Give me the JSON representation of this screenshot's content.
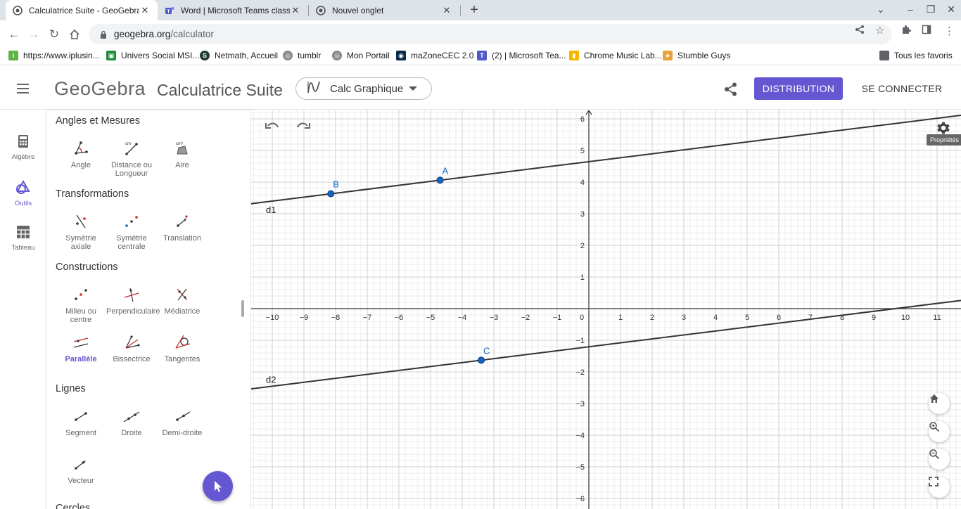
{
  "browser": {
    "tabs": [
      {
        "title": "Calculatrice Suite - GeoGebra",
        "active": true
      },
      {
        "title": "Word | Microsoft Teams classic",
        "active": false
      },
      {
        "title": "Nouvel onglet",
        "active": false
      }
    ],
    "url_domain": "geogebra.org",
    "url_path": "/calculator",
    "bookmarks": [
      "https://www.iplusin...",
      "Univers Social MSI...",
      "Netmath, Accueil",
      "tumblr",
      "Mon Portail",
      "maZoneCEC 2.0",
      "(2) | Microsoft Tea...",
      "Chrome Music Lab...",
      "Stumble Guys"
    ],
    "all_bookmarks": "Tous les favoris"
  },
  "header": {
    "logo": "GeoGebra",
    "app_name": "Calculatrice Suite",
    "app_select": "Calc Graphique",
    "distribution_label": "DISTRIBUTION",
    "login_label": "SE CONNECTER"
  },
  "rail": {
    "algebra": "Algèbre",
    "tools": "Outils",
    "table": "Tableau"
  },
  "tools_panel": {
    "categories": {
      "angles": "Angles et Mesures",
      "transformations": "Transformations",
      "constructions": "Constructions",
      "lines": "Lignes",
      "cut": "Cercles"
    },
    "tools": {
      "angle": "Angle",
      "distance": "Distance ou Longueur",
      "area": "Aire",
      "reflect_line": "Symétrie axiale",
      "reflect_point": "Symétrie centrale",
      "translation": "Translation",
      "midpoint": "Milieu ou centre",
      "perpendicular": "Perpendiculaire",
      "bisector_perp": "Médiatrice",
      "parallel": "Parallèle",
      "angle_bisector": "Bissectrice",
      "tangents": "Tangentes",
      "segment": "Segment",
      "line": "Droite",
      "ray": "Demi-droite",
      "vector": "Vecteur"
    }
  },
  "graphics": {
    "x_ticks": [
      -10,
      -9,
      -8,
      -7,
      -6,
      -5,
      -4,
      -3,
      -2,
      -1,
      0,
      1,
      2,
      3,
      4,
      5,
      6,
      7,
      8,
      9,
      10,
      11
    ],
    "y_ticks": [
      6,
      5,
      4,
      3,
      2,
      1,
      -1,
      -2,
      -3,
      -4,
      -5,
      -6
    ],
    "settings_tooltip": "Propriétés",
    "points": [
      {
        "label": "A",
        "x": -4.7,
        "y": 4.06
      },
      {
        "label": "B",
        "x": -8.15,
        "y": 3.63
      },
      {
        "label": "C",
        "x": -3.4,
        "y": -1.63
      }
    ],
    "lines": [
      {
        "label": "d1",
        "through": [
          "A",
          "B"
        ]
      },
      {
        "label": "d2",
        "through": [
          "C"
        ]
      }
    ],
    "colors": {
      "point": "#1565c0",
      "line": "#333333",
      "accent": "#6557d2"
    }
  }
}
